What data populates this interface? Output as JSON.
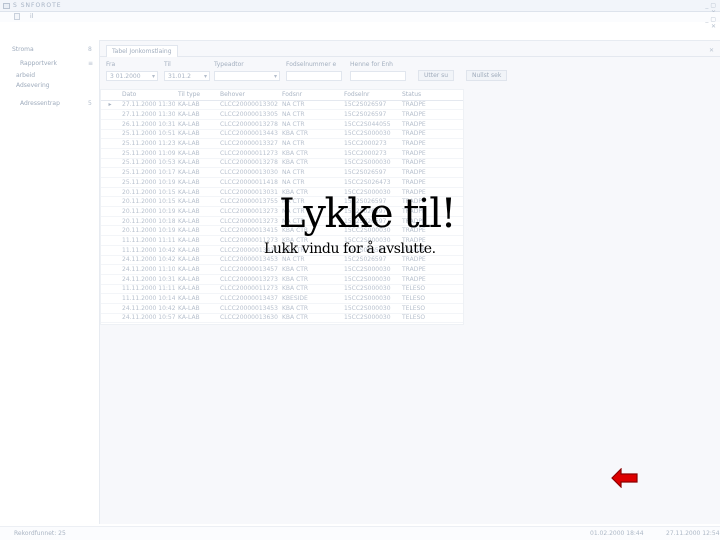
{
  "window": {
    "title": "S SNFOROTE",
    "controls": "_ ▢ ✕"
  },
  "menubar": {
    "item": "il"
  },
  "sidebar": {
    "items": [
      {
        "label": "Stroma",
        "caret": "8"
      },
      {
        "label": "Rapportverk",
        "caret": "≡"
      },
      {
        "label": "arbeid",
        "caret": ""
      },
      {
        "label": "Adsevering",
        "caret": ""
      },
      {
        "label": "Adressentrap",
        "caret": "5"
      }
    ]
  },
  "tabs": {
    "items": [
      {
        "label": "Tabel Jonkomstlaing"
      }
    ],
    "close": "✕"
  },
  "filters": {
    "fra_label": "Fra",
    "fra_value": "3 01.2000",
    "til_label": "Til",
    "til_value": "31.01.2",
    "type_label": "Typeadtor",
    "type_value": "",
    "field4_label": "Fodselnummer e",
    "field4_value": "",
    "field5_label": "Henne for Enh",
    "field5_value": "",
    "search_button": "Utter su",
    "reset_button": "Nullst sek"
  },
  "grid": {
    "columns": [
      "",
      "Dato",
      "Til type",
      "Behover",
      "Fodsnr",
      "Fodselnr",
      "Status"
    ],
    "rows": [
      [
        "▸",
        "27.11.2000 11:30",
        "KA-LAB",
        "CLCC20000013302",
        "NA CTR",
        "15C2S026597",
        "TRADPE"
      ],
      [
        "",
        "27.11.2000 11:30",
        "KA-LAB",
        "CLCC20000013305",
        "NA CTR",
        "15C2S026597",
        "TRADPE"
      ],
      [
        "",
        "26.11.2000 10:31",
        "KA-LAB",
        "CLCC20000013278",
        "NA CTR",
        "15CC2S044055",
        "TRADPE"
      ],
      [
        "",
        "25.11.2000 10:51",
        "KA-LAB",
        "CLCC20000013443",
        "KBA CTR",
        "15CC2S000030",
        "TRADPE"
      ],
      [
        "",
        "25.11.2000 11:23",
        "KA-LAB",
        "CLCC20000013327",
        "NA CTR",
        "15CC2000273",
        "TRADPE"
      ],
      [
        "",
        "25.11.2000 11:09",
        "KA-LAB",
        "CLCC20000011273",
        "KBA CTR",
        "15CC2000273",
        "TRADPE"
      ],
      [
        "",
        "25.11.2000 10:53",
        "KA-LAB",
        "CLCC20000013278",
        "KBA CTR",
        "15CC2S000030",
        "TRADPE"
      ],
      [
        "",
        "25.11.2000 10:17",
        "KA-LAB",
        "CLCC20000013030",
        "NA CTR",
        "15C2S026597",
        "TRADPE"
      ],
      [
        "",
        "25.11.2000 10:19",
        "KA-LAB",
        "CLCC20000011418",
        "NA CTR",
        "15CC2S026473",
        "TRADPE"
      ],
      [
        "",
        "20.11.2000 10:15",
        "KA-LAB",
        "CLCC20000013031",
        "KBA CTR",
        "15CC2S000030",
        "TRADPE"
      ],
      [
        "",
        "20.11.2000 10:15",
        "KA-LAB",
        "CLCC20000013755",
        "NA CTR",
        "15C2S026597",
        "TRADPE"
      ],
      [
        "",
        "20.11.2000 10:19",
        "KA-LAB",
        "CLCC20000013273",
        "NA CTR",
        "15C2S026597",
        "TRADPE"
      ],
      [
        "",
        "20.11.2000 10:18",
        "KA-LAB",
        "CLCC20000013273",
        "NA CTR",
        "15C2S026597",
        "TRADPE"
      ],
      [
        "",
        "20.11.2000 10:19",
        "KA-LAB",
        "CLCC20000013415",
        "KBA CTR",
        "15CC2S000030",
        "TRADPE"
      ],
      [
        "",
        "11.11.2000 11:11",
        "KA-LAB",
        "CLCC20000011273",
        "KBA CTR",
        "15CC2S000030",
        "TRADPE"
      ],
      [
        "",
        "11.11.2000 10:42",
        "KA-LAB",
        "CLCC20000013437",
        "NA CTR",
        "15C2S026597",
        "TRADPE"
      ],
      [
        "",
        "24.11.2000 10:42",
        "KA-LAB",
        "CLCC20000013453",
        "NA CTR",
        "15C2S026597",
        "TRADPE"
      ],
      [
        "",
        "24.11.2000 11:10",
        "KA-LAB",
        "CLCC20000013457",
        "KBA CTR",
        "15CC2S000030",
        "TRADPE"
      ],
      [
        "",
        "24.11.2000 10:31",
        "KA-LAB",
        "CLCC20000013273",
        "KBA CTR",
        "15CC2S000030",
        "TRADPE"
      ],
      [
        "",
        "11.11.2000 11:11",
        "KA-LAB",
        "CLCC20000011273",
        "KBA CTR",
        "15CC2S000030",
        "TELESO"
      ],
      [
        "",
        "11.11.2000 10:14",
        "KA-LAB",
        "CLCC20000013437",
        "KBESIDE",
        "15CC2S000030",
        "TELESO"
      ],
      [
        "",
        "24.11.2000 10:42",
        "KA-LAB",
        "CLCC20000013453",
        "KBA CTR",
        "15CC2S000030",
        "TELESO"
      ],
      [
        "",
        "24.11.2000 10:57",
        "KA-LAB",
        "CLCC20000013630",
        "KBA CTR",
        "15CC2S000030",
        "TELESO"
      ],
      [
        "",
        "24.11.2000 10:31",
        "KA-LAB",
        "CLCC20000013437",
        "KBESIDE",
        "15CC2000273",
        "TELESO"
      ],
      [
        "",
        "24.11.2000 10:11",
        "KA-LAB",
        "CLCC20000011273",
        "KBESIDE",
        "15CC2S000030",
        "TELESO"
      ]
    ]
  },
  "overlay": {
    "title": "Lykke til!",
    "subtitle": "Lukk vindu for å avslutte."
  },
  "status": {
    "left": "Rekordfunnet: 25",
    "mid": "01.02.2000  18:44",
    "right": "27.11.2000  12:54"
  },
  "colors": {
    "arrow_fill": "#dd0000",
    "arrow_stroke": "#8b0000"
  },
  "icons": {
    "exit_arrow": "left-arrow-icon"
  }
}
